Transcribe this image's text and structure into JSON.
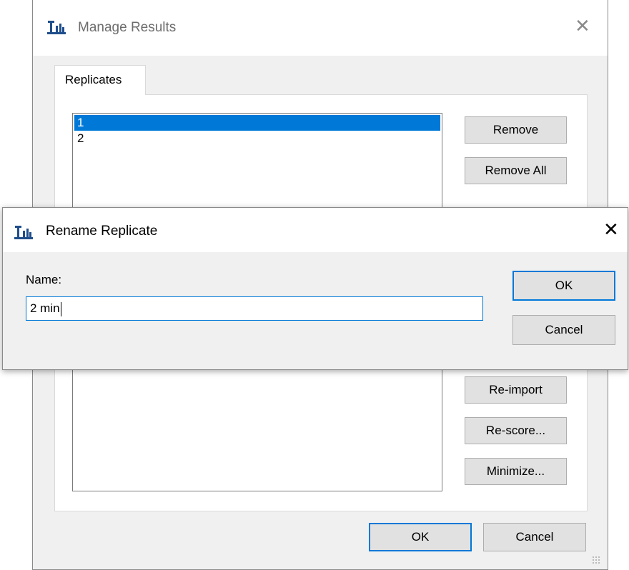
{
  "manage_results": {
    "title": "Manage Results",
    "tab_label": "Replicates",
    "replicates": [
      "1",
      "2"
    ],
    "buttons": {
      "remove": "Remove",
      "remove_all": "Remove All",
      "reimport": "Re-import",
      "rescore": "Re-score...",
      "minimize": "Minimize...",
      "ok": "OK",
      "cancel": "Cancel"
    }
  },
  "rename_dialog": {
    "title": "Rename Replicate",
    "name_label": "Name:",
    "name_value": "2 min",
    "ok": "OK",
    "cancel": "Cancel"
  },
  "icons": {
    "app_icon": "skyline-app-icon",
    "close_icon": "close-icon"
  },
  "colors": {
    "selection": "#0078d7",
    "app_icon": "#1f4e8c"
  }
}
